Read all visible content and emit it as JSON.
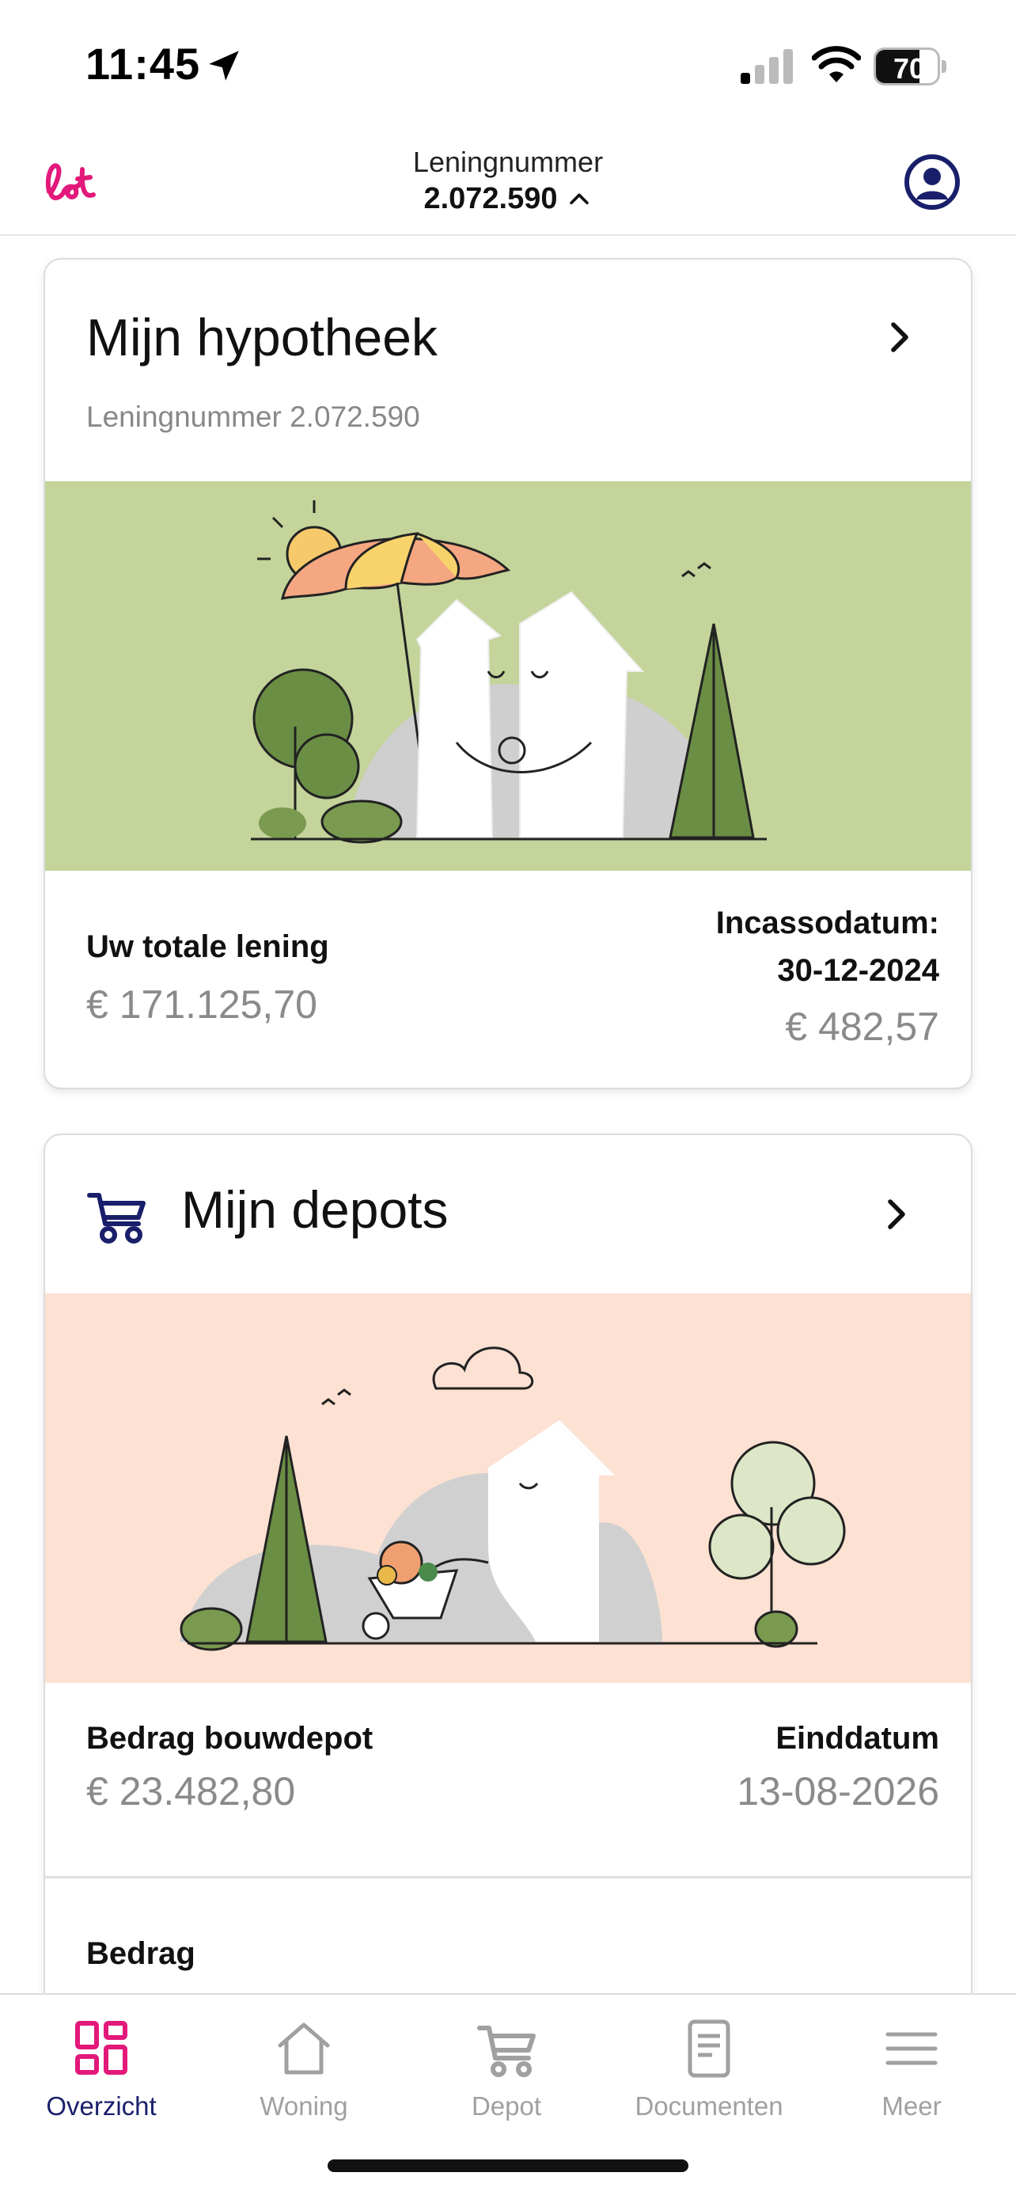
{
  "status_bar": {
    "time": "11:45",
    "battery_text": "70",
    "battery_level": 0.7,
    "icons": [
      "location-arrow-icon",
      "signal-icon",
      "wifi-icon",
      "battery-icon"
    ]
  },
  "header": {
    "loan_label": "Leningnummer",
    "loan_number": "2.072.590",
    "logo_icon": "lot-logo",
    "profile_icon": "profile-icon",
    "accent_color": "#e2197a",
    "nav_color": "#1a1f6b"
  },
  "mortgage_card": {
    "title": "Mijn hypotheek",
    "subtitle": "Leningnummer 2.072.590",
    "illustration_bg": "#c4d49b",
    "total_label": "Uw totale lening",
    "total_value": "€ 171.125,70",
    "collection_label_line1": "Incassodatum:",
    "collection_label_line2": "30-12-2024",
    "collection_value": "€ 482,57"
  },
  "depot_card": {
    "title": "Mijn depots",
    "illustration_bg": "#fde1d3",
    "build_label": "Bedrag bouwdepot",
    "build_value": "€ 23.482,80",
    "end_label": "Einddatum",
    "end_value": "13-08-2026",
    "second_label": "Bedrag"
  },
  "bottom_nav": {
    "items": [
      {
        "label": "Overzicht",
        "icon": "dashboard-icon",
        "active": true
      },
      {
        "label": "Woning",
        "icon": "home-icon",
        "active": false
      },
      {
        "label": "Depot",
        "icon": "cart-icon",
        "active": false
      },
      {
        "label": "Documenten",
        "icon": "document-icon",
        "active": false
      },
      {
        "label": "Meer",
        "icon": "menu-icon",
        "active": false
      }
    ]
  }
}
